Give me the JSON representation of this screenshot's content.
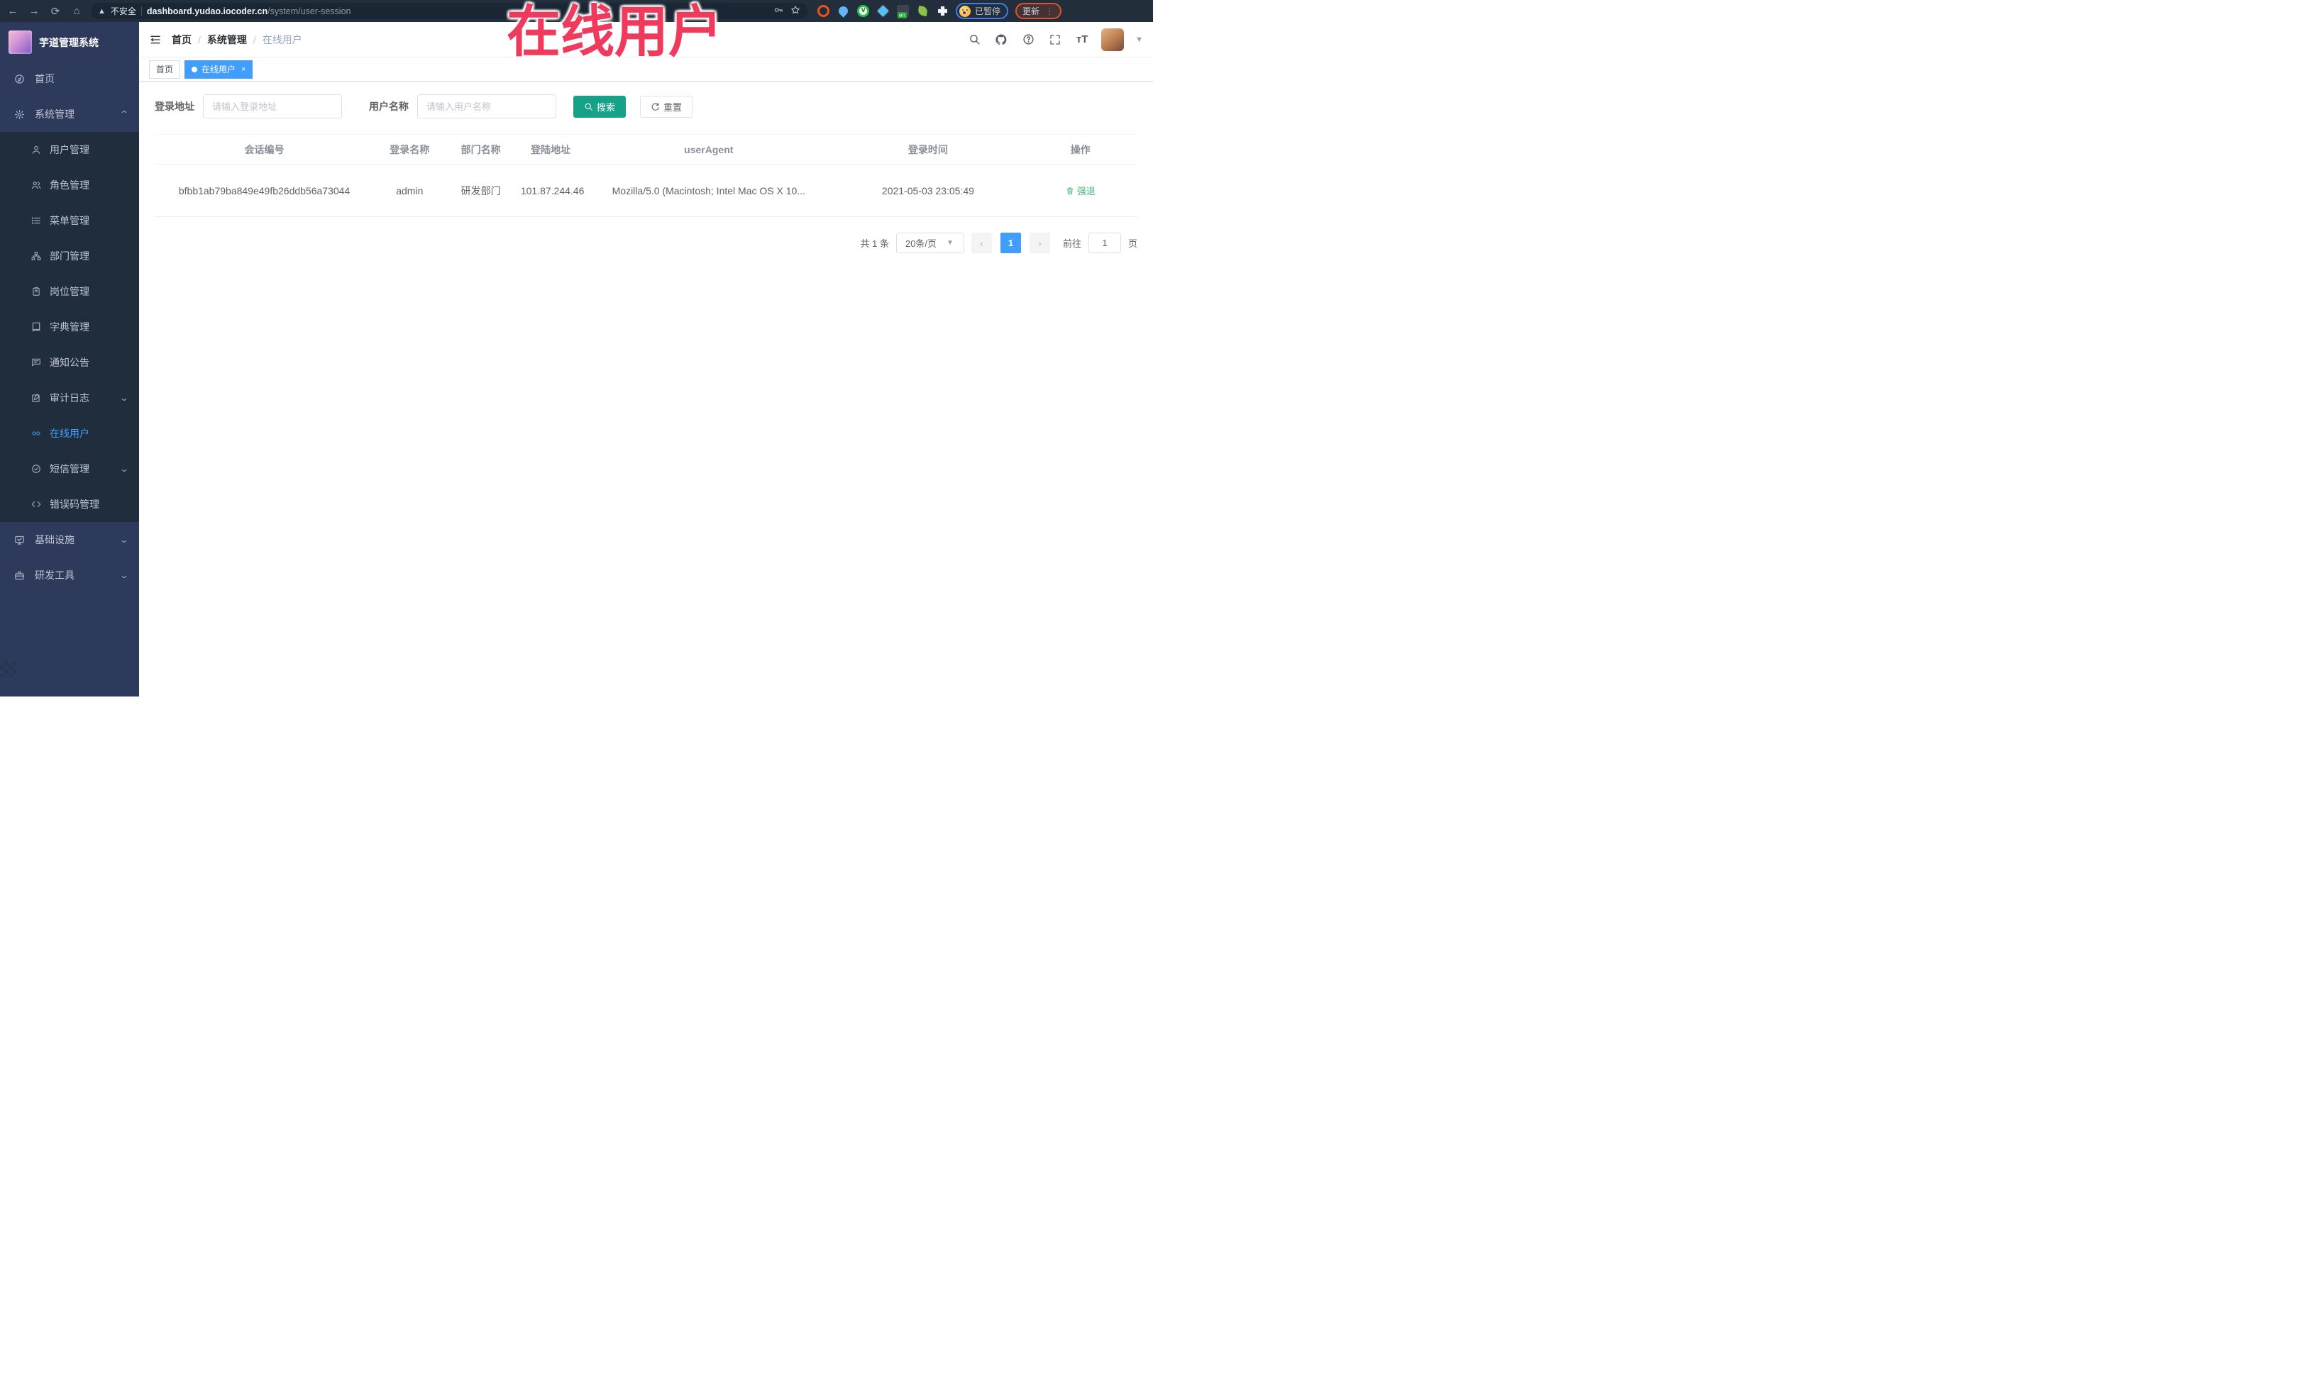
{
  "browser": {
    "security_label": "不安全",
    "url_domain": "dashboard.yudao.iocoder.cn",
    "url_path": "/system/user-session",
    "paused_badge_label": "已暂停",
    "update_button_label": "更新",
    "icons": [
      "back-icon",
      "forward-icon",
      "reload-icon",
      "home-icon",
      "warning-icon",
      "key-icon",
      "star-icon",
      "ubuntu-extension-icon",
      "drop-extension-icon",
      "green-v-extension-icon",
      "gem-extension-icon",
      "en-translate-extension-icon",
      "leaf-extension-icon",
      "puzzle-extensions-icon"
    ]
  },
  "annotation": {
    "text": "在线用户",
    "color": "#ee3a5c"
  },
  "sidebar": {
    "app_title": "芋道管理系统",
    "top_items": [
      {
        "label": "首页"
      }
    ],
    "system_group": {
      "label": "系统管理"
    },
    "system_children": [
      {
        "label": "用户管理"
      },
      {
        "label": "角色管理"
      },
      {
        "label": "菜单管理"
      },
      {
        "label": "部门管理"
      },
      {
        "label": "岗位管理"
      },
      {
        "label": "字典管理"
      },
      {
        "label": "通知公告"
      },
      {
        "label": "审计日志",
        "has_arrow": true
      },
      {
        "label": "在线用户",
        "active": true
      },
      {
        "label": "短信管理",
        "has_arrow": true
      },
      {
        "label": "错误码管理"
      }
    ],
    "bottom_groups": [
      {
        "label": "基础设施"
      },
      {
        "label": "研发工具"
      }
    ]
  },
  "header": {
    "breadcrumb": [
      {
        "label": "首页"
      },
      {
        "label": "系统管理"
      },
      {
        "label": "在线用户"
      }
    ],
    "right_icons": [
      "search-icon",
      "github-icon",
      "help-icon",
      "fullscreen-icon",
      "font-size-icon",
      "avatar",
      "caret-down-icon"
    ]
  },
  "tabs": [
    {
      "label": "首页",
      "active": false
    },
    {
      "label": "在线用户",
      "active": true
    }
  ],
  "filters": {
    "login_address_label": "登录地址",
    "login_address_placeholder": "请输入登录地址",
    "username_label": "用户名称",
    "username_placeholder": "请输入用户名称",
    "search_label": "搜索",
    "reset_label": "重置"
  },
  "table": {
    "columns": [
      "会话编号",
      "登录名称",
      "部门名称",
      "登陆地址",
      "userAgent",
      "登录时间",
      "操作"
    ],
    "rows": [
      {
        "session_id": "bfbb1ab79ba849e49fb26ddb56a73044",
        "login_name": "admin",
        "dept_name": "研发部门",
        "login_ip": "101.87.244.46",
        "user_agent": "Mozilla/5.0 (Macintosh; Intel Mac OS X 10...",
        "login_time": "2021-05-03 23:05:49",
        "action_label": "强退"
      }
    ]
  },
  "pagination": {
    "total_text": "共 1 条",
    "page_size_label": "20条/页",
    "current_page": "1",
    "goto_label": "前往",
    "goto_value": "1",
    "page_unit_label": "页"
  },
  "colors": {
    "accent_blue": "#409EFF",
    "search_button_teal": "#16A286",
    "action_green": "#48b87f",
    "sidebar_navy": "#2d3a5c",
    "submenu_dark": "#1f2d3d"
  }
}
